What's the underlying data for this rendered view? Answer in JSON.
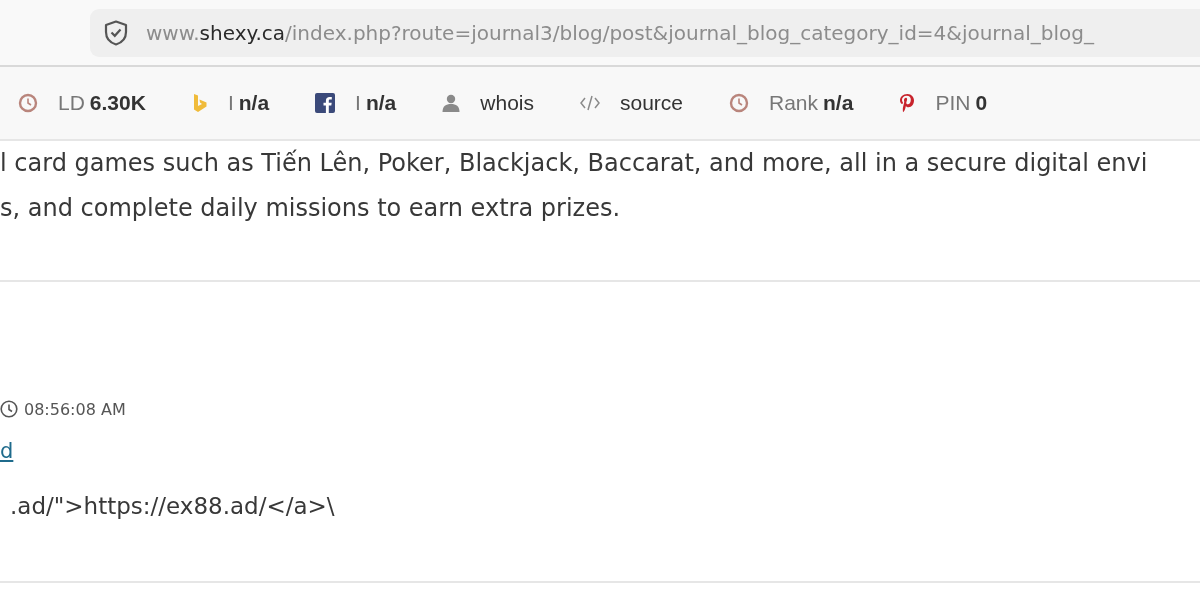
{
  "address_bar": {
    "prefix": "www.",
    "host": "shexy.ca",
    "path": "/index.php?route=journal3/blog/post&journal_blog_category_id=4&journal_blog_"
  },
  "toolbar": [
    {
      "label": "LD",
      "value": "6.30K"
    },
    {
      "label": "I",
      "value": "n/a"
    },
    {
      "label": "I",
      "value": "n/a"
    },
    {
      "label": "whois"
    },
    {
      "label": "source"
    },
    {
      "label": "Rank",
      "value": "n/a"
    },
    {
      "label": "PIN",
      "value": "0"
    }
  ],
  "article": {
    "lines": [
      "l card games such as Tiến Lên, Poker, Blackjack, Baccarat, and more, all in a secure digital envi",
      "s, and complete daily missions to earn extra prizes."
    ]
  },
  "post_meta": {
    "time": "08:56:08 AM",
    "link": "d",
    "code_line": ".ad/\">https://ex88.ad/</a>\\"
  }
}
